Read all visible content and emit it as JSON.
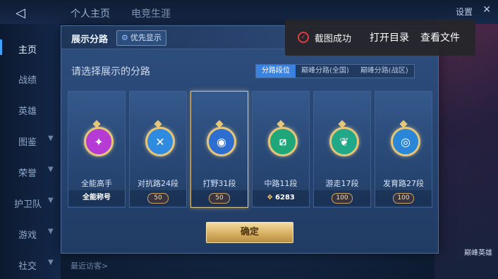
{
  "top": {
    "tabs": [
      "个人主页",
      "电竞生涯"
    ],
    "settings": "设置",
    "close": "✕"
  },
  "nav": [
    {
      "label": "主页",
      "active": true
    },
    {
      "label": "战绩"
    },
    {
      "label": "英雄"
    },
    {
      "label": "图鉴",
      "chevron": true
    },
    {
      "label": "荣誉",
      "chevron": true
    },
    {
      "label": "护卫队",
      "chevron": true
    },
    {
      "label": "游戏",
      "chevron": true
    },
    {
      "label": "社交",
      "chevron": true
    }
  ],
  "bottom_hint": "最近访客>",
  "right_badge": "巅峰英雄",
  "modal": {
    "title": "展示分路",
    "priority_button": "优先显示",
    "subtitle": "请选择展示的分路",
    "tabs": [
      {
        "label": "分路段位",
        "active": true
      },
      {
        "label": "巅峰分路(全国)"
      },
      {
        "label": "巅峰分路(战区)"
      }
    ],
    "cards": [
      {
        "name": "全能高手",
        "footer": "全能称号",
        "emblem_color": "#b63bd4",
        "glyph": "✦"
      },
      {
        "name": "对抗路24段",
        "badge": "50",
        "emblem_color": "#2e8be0",
        "glyph": "✕"
      },
      {
        "name": "打野31段",
        "badge": "50",
        "emblem_color": "#2f6ed1",
        "glyph": "◉",
        "selected": true
      },
      {
        "name": "中路11段",
        "footer": "6283",
        "emblem_color": "#1fa77a",
        "glyph": "⧄"
      },
      {
        "name": "游走17段",
        "badge": "100",
        "emblem_color": "#21a889",
        "glyph": "❦"
      },
      {
        "name": "发育路27段",
        "badge": "100",
        "emblem_color": "#2a86d6",
        "glyph": "◎"
      }
    ],
    "confirm": "确定"
  },
  "toast": {
    "message": "截图成功",
    "action_open": "打开目录",
    "action_view": "查看文件"
  }
}
